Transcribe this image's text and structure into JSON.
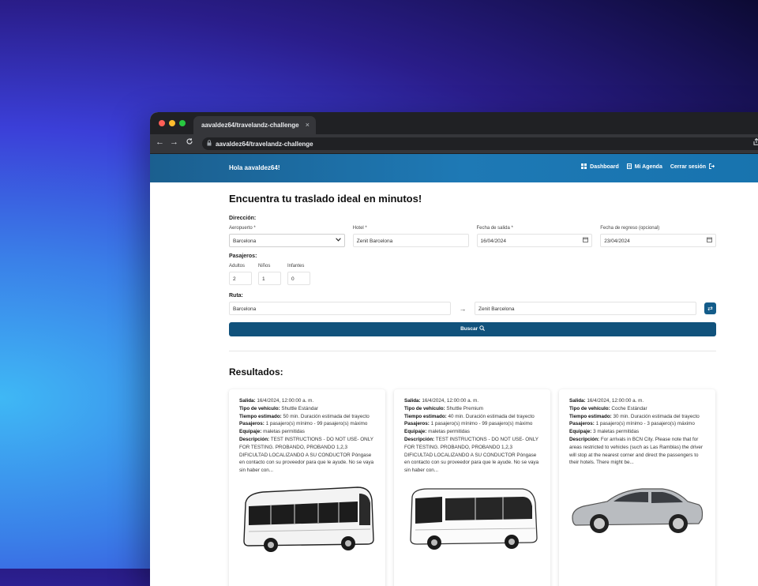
{
  "browser": {
    "tab_title": "aavaldez64/travelandz-challenge",
    "tab_close": "×",
    "url": "aavaldez64/travelandz-challenge",
    "nav_back": "←",
    "nav_forward": "→",
    "nav_reload": "C"
  },
  "header": {
    "greeting": "Hola aavaldez64!",
    "links": [
      {
        "icon": "dashboard-icon",
        "label": "Dashboard"
      },
      {
        "icon": "agenda-icon",
        "label": "Mi Agenda"
      },
      {
        "icon": "logout-icon",
        "label": "Cerrar sesión"
      }
    ]
  },
  "form": {
    "title": "Encuentra tu traslado ideal en minutos!",
    "direccion_label": "Dirección:",
    "aeropuerto_label": "Aeropuerto *",
    "aeropuerto_value": "Barcelona",
    "hotel_label": "Hotel *",
    "hotel_value": "Zenit Barcelona",
    "salida_label": "Fecha de salida *",
    "salida_value": "16/04/2024",
    "regreso_label": "Fecha de regreso (opcional)",
    "regreso_value": "23/04/2024",
    "pasajeros_label": "Pasajeros:",
    "adultos_label": "Adultos",
    "adultos_value": "2",
    "ninos_label": "Niños",
    "ninos_value": "1",
    "infantes_label": "Infantes",
    "infantes_value": "0",
    "ruta_label": "Ruta:",
    "ruta_from": "Barcelona",
    "ruta_to": "Zenit Barcelona",
    "buscar_label": "Buscar"
  },
  "results": {
    "title": "Resultados:",
    "cards": [
      {
        "salida_k": "Salida:",
        "salida": "16/4/2024, 12:00:00 a. m.",
        "tipo_k": "Tipo de vehículo:",
        "tipo": "Shuttle Estándar",
        "tiempo_k": "Tiempo estimado:",
        "tiempo": "50 min. Duración estimada del trayecto",
        "pasajeros_k": "Pasajeros:",
        "pasajeros": "1 pasajero(s) mínimo - 99 pasajero(s) máximo",
        "equipaje_k": "Equipaje:",
        "equipaje": "maletas permitidas",
        "descripcion_k": "Descripción:",
        "descripcion": "TEST INSTRUCTIONS - DO NOT USE- ONLY FOR TESTING. PROBANDO, PROBANDO 1,2,3 DIFICULTAD LOCALIZANDO A SU CONDUCTOR Póngase en contacto con su proveedor para que le ayude. No se vaya sin haber con...",
        "vehicle": "bus"
      },
      {
        "salida_k": "Salida:",
        "salida": "16/4/2024, 12:00:00 a. m.",
        "tipo_k": "Tipo de vehículo:",
        "tipo": "Shuttle Premium",
        "tiempo_k": "Tiempo estimado:",
        "tiempo": "40 min. Duración estimada del trayecto",
        "pasajeros_k": "Pasajeros:",
        "pasajeros": "1 pasajero(s) mínimo - 99 pasajero(s) máximo",
        "equipaje_k": "Equipaje:",
        "equipaje": "maletas permitidas",
        "descripcion_k": "Descripción:",
        "descripcion": "TEST INSTRUCTIONS - DO NOT USE- ONLY FOR TESTING. PROBANDO, PROBANDO 1,2,3 DIFICULTAD LOCALIZANDO A SU CONDUCTOR Póngase en contacto con su proveedor para que le ayude. No se vaya sin haber con...",
        "vehicle": "coach"
      },
      {
        "salida_k": "Salida:",
        "salida": "16/4/2024, 12:00:00 a. m.",
        "tipo_k": "Tipo de vehículo:",
        "tipo": "Coche Estándar",
        "tiempo_k": "Tiempo estimado:",
        "tiempo": "30 min. Duración estimada del trayecto",
        "pasajeros_k": "Pasajeros:",
        "pasajeros": "1 pasajero(s) mínimo - 3 pasajero(s) máximo",
        "equipaje_k": "Equipaje:",
        "equipaje": "3 maletas permitidas",
        "descripcion_k": "Descripción:",
        "descripcion": "For arrivals in BCN City. Please note that for areas restricted to vehicles (such as Las Ramblas) the driver will stop at the nearest corner and direct the passengers to their hotels. There might be...",
        "vehicle": "car"
      }
    ]
  }
}
